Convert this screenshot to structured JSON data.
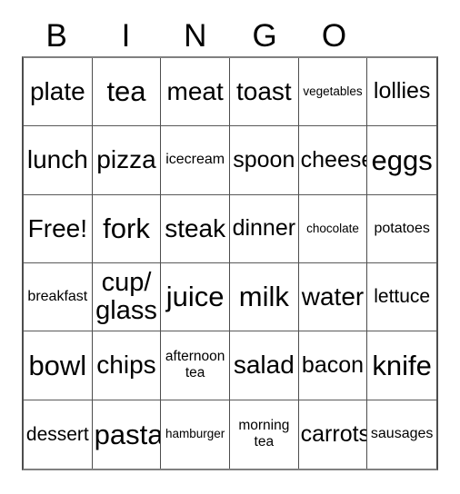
{
  "card": {
    "title_letters": [
      "B",
      "I",
      "N",
      "G",
      "O",
      ""
    ],
    "columns": 6,
    "rows": 6,
    "free_space_label": "Free!",
    "colors": {
      "text": "#000000",
      "grid_line": "#4d4d4d",
      "background": "#ffffff"
    }
  },
  "grid": {
    "rows": [
      [
        {
          "text": "plate",
          "size": "lg"
        },
        {
          "text": "tea",
          "size": "xl"
        },
        {
          "text": "meat",
          "size": "lg"
        },
        {
          "text": "toast",
          "size": "lg"
        },
        {
          "text": "vegetables",
          "size": "xxs"
        },
        {
          "text": "lollies",
          "size": "md"
        }
      ],
      [
        {
          "text": "lunch",
          "size": "lg"
        },
        {
          "text": "pizza",
          "size": "lg"
        },
        {
          "text": "icecream",
          "size": "xs"
        },
        {
          "text": "spoon",
          "size": "md"
        },
        {
          "text": "cheese",
          "size": "md"
        },
        {
          "text": "eggs",
          "size": "xl"
        }
      ],
      [
        {
          "text": "Free!",
          "size": "lg"
        },
        {
          "text": "fork",
          "size": "xl"
        },
        {
          "text": "steak",
          "size": "lg"
        },
        {
          "text": "dinner",
          "size": "md"
        },
        {
          "text": "chocolate",
          "size": "xxs"
        },
        {
          "text": "potatoes",
          "size": "xs"
        }
      ],
      [
        {
          "text": "breakfast",
          "size": "xs"
        },
        {
          "text": "cup/\nglass",
          "size": "two-lg"
        },
        {
          "text": "juice",
          "size": "xl"
        },
        {
          "text": "milk",
          "size": "xl"
        },
        {
          "text": "water",
          "size": "lg"
        },
        {
          "text": "lettuce",
          "size": "sm"
        }
      ],
      [
        {
          "text": "bowl",
          "size": "xl"
        },
        {
          "text": "chips",
          "size": "lg"
        },
        {
          "text": "afternoon\ntea",
          "size": "two"
        },
        {
          "text": "salad",
          "size": "lg"
        },
        {
          "text": "bacon",
          "size": "md"
        },
        {
          "text": "knife",
          "size": "xl"
        }
      ],
      [
        {
          "text": "dessert",
          "size": "sm"
        },
        {
          "text": "pasta",
          "size": "xl"
        },
        {
          "text": "hamburger",
          "size": "xxs"
        },
        {
          "text": "morning\ntea",
          "size": "two"
        },
        {
          "text": "carrots",
          "size": "md"
        },
        {
          "text": "sausages",
          "size": "xs"
        }
      ]
    ]
  }
}
